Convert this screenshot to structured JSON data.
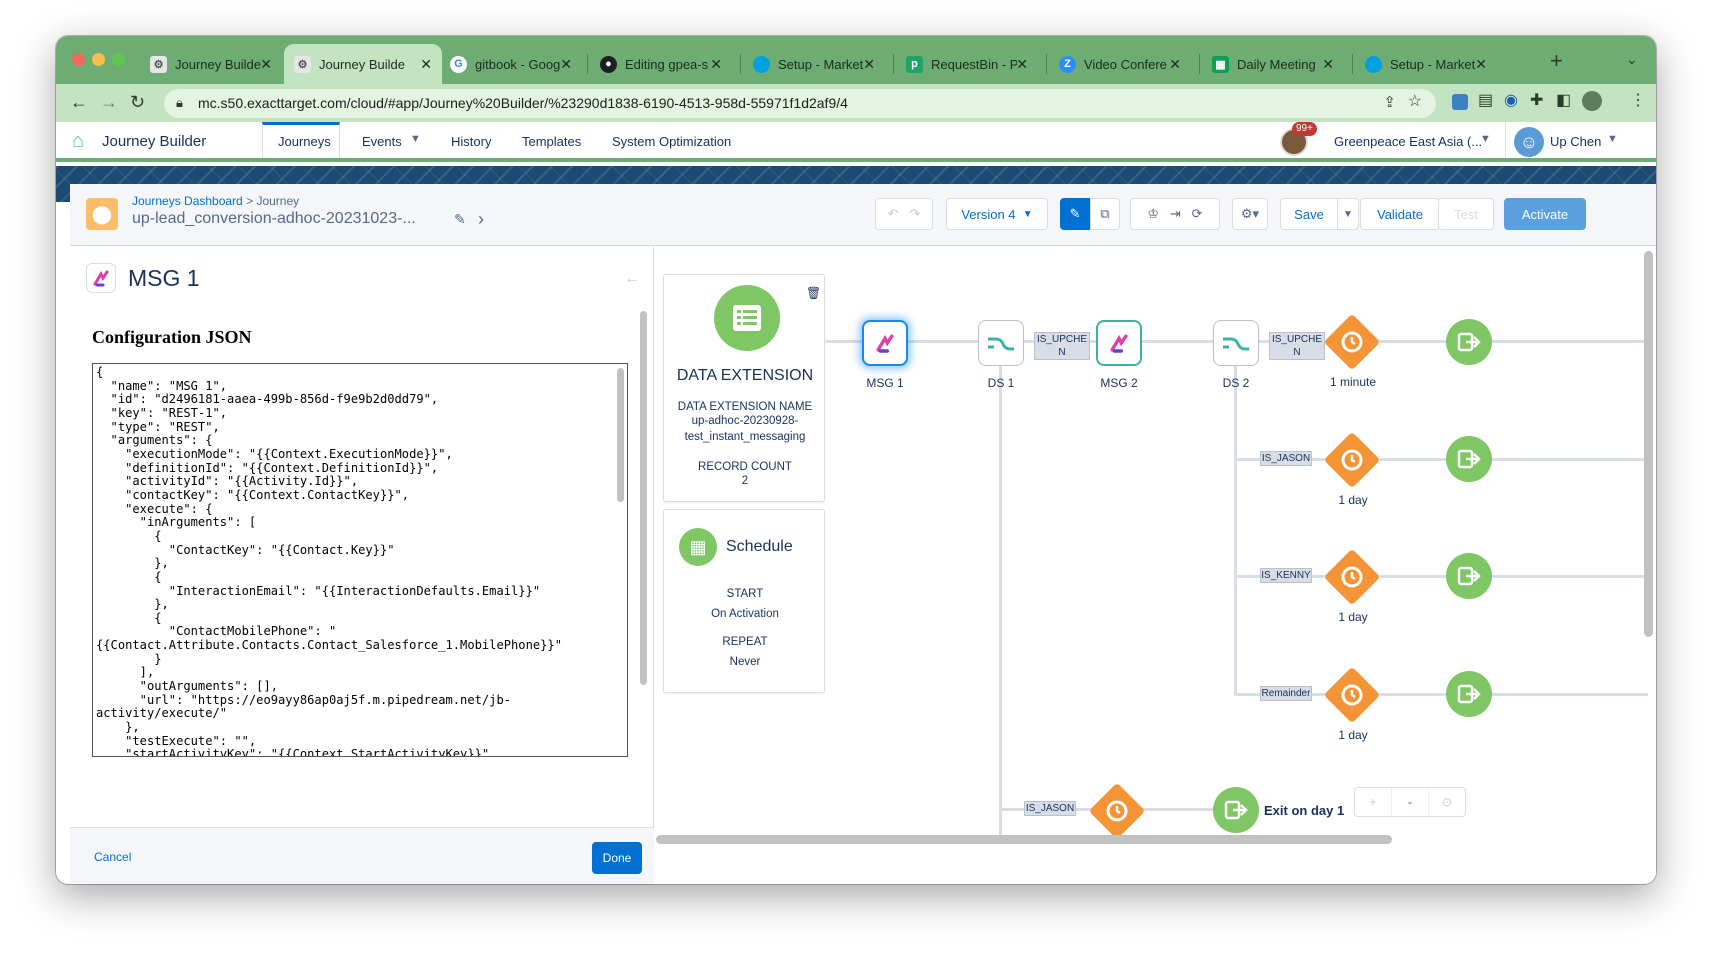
{
  "browser": {
    "tabs": [
      {
        "title": "Journey Builde",
        "favicon": "gear-icon",
        "active": false
      },
      {
        "title": "Journey Builde",
        "favicon": "gear-icon",
        "active": true
      },
      {
        "title": "gitbook - Goog",
        "favicon": "google-icon",
        "active": false
      },
      {
        "title": "Editing gpea-s",
        "favicon": "github-icon",
        "active": false
      },
      {
        "title": "Setup - Market",
        "favicon": "salesforce-icon",
        "active": false
      },
      {
        "title": "RequestBin - P",
        "favicon": "pipedream-icon",
        "active": false
      },
      {
        "title": "Video Confere",
        "favicon": "zoom-icon",
        "active": false
      },
      {
        "title": "Daily Meeting",
        "favicon": "sheets-icon",
        "active": false
      },
      {
        "title": "Setup - Market",
        "favicon": "salesforce-icon",
        "active": false
      }
    ],
    "url": "mc.s50.exacttarget.com/cloud/#app/Journey%20Builder/%23290d1838-6190-4513-958d-55971f1d2af9/4"
  },
  "app_nav": {
    "app_name": "Journey Builder",
    "items": [
      "Journeys",
      "Events",
      "History",
      "Templates",
      "System Optimization"
    ],
    "active": "Journeys",
    "notification_count": "99+",
    "business_unit": "Greenpeace East Asia (...",
    "user": "Up Chen"
  },
  "journey_header": {
    "breadcrumb_parent": "Journeys Dashboard",
    "breadcrumb_sep": ">",
    "breadcrumb_current": "Journey",
    "journey_name": "up-lead_conversion-adhoc-20231023-...",
    "version": "Version 4",
    "save": "Save",
    "validate": "Validate",
    "test": "Test",
    "activate": "Activate"
  },
  "config_panel": {
    "title": "MSG 1",
    "section_title": "Configuration JSON",
    "json": "{\n  \"name\": \"MSG 1\",\n  \"id\": \"d2496181-aaea-499b-856d-f9e9b2d0dd79\",\n  \"key\": \"REST-1\",\n  \"type\": \"REST\",\n  \"arguments\": {\n    \"executionMode\": \"{{Context.ExecutionMode}}\",\n    \"definitionId\": \"{{Context.DefinitionId}}\",\n    \"activityId\": \"{{Activity.Id}}\",\n    \"contactKey\": \"{{Context.ContactKey}}\",\n    \"execute\": {\n      \"inArguments\": [\n        {\n          \"ContactKey\": \"{{Contact.Key}}\"\n        },\n        {\n          \"InteractionEmail\": \"{{InteractionDefaults.Email}}\"\n        },\n        {\n          \"ContactMobilePhone\": \"\n{{Contact.Attribute.Contacts.Contact_Salesforce_1.MobilePhone}}\"\n        }\n      ],\n      \"outArguments\": [],\n      \"url\": \"https://eo9ayy86ap0aj5f.m.pipedream.net/jb-\nactivity/execute/\"\n    },\n    \"testExecute\": \"\",\n    \"startActivityKey\": \"{{Context.StartActivityKey}}\"",
    "cancel": "Cancel",
    "done": "Done"
  },
  "canvas": {
    "entry": {
      "title": "DATA EXTENSION",
      "name_label": "DATA EXTENSION NAME",
      "name_line1": "up-adhoc-20230928-",
      "name_line2": "test_instant_messaging",
      "count_label": "RECORD COUNT",
      "count": "2"
    },
    "schedule": {
      "title": "Schedule",
      "start_label": "START",
      "start_value": "On Activation",
      "repeat_label": "REPEAT",
      "repeat_value": "Never"
    },
    "activities": {
      "msg1": "MSG 1",
      "ds1": "DS 1",
      "msg2": "MSG 2",
      "ds2": "DS 2"
    },
    "paths": {
      "p1_line1": "IS_UPCHE",
      "p1_line2": "N",
      "p2_line1": "IS_UPCHE",
      "p2_line2": "N",
      "jason": "IS_JASON",
      "kenny": "IS_KENNY",
      "remainder": "Remainder",
      "jason_bottom": "IS_JASON"
    },
    "waits": {
      "w1": "1 minute",
      "w2": "1 day",
      "w3": "1 day",
      "w4": "1 day"
    },
    "exit_label": "Exit on day 1",
    "zoom_controls": [
      "+",
      "-",
      "⊙"
    ]
  },
  "colors": {
    "chrome_green": "#6dad73",
    "sf_blue": "#0070d2",
    "entry_green": "#7fc665",
    "wait_orange": "#f49437",
    "msg_pink": "#e03ea8"
  }
}
